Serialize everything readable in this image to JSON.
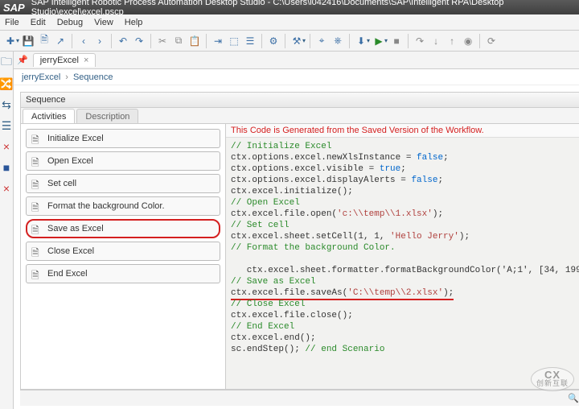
{
  "title": "SAP Intelligent Robotic Process Automation Desktop Studio - C:\\Users\\i042416\\Documents\\SAP\\Intelligent RPA\\Desktop Studio\\excel\\excel.pscp",
  "menu": {
    "file": "File",
    "edit": "Edit",
    "debug": "Debug",
    "view": "View",
    "help": "Help"
  },
  "tab": {
    "name": "jerryExcel"
  },
  "breadcrumb": {
    "root": "jerryExcel",
    "leaf": "Sequence"
  },
  "seq": {
    "title": "Sequence"
  },
  "subtabs": {
    "activities": "Activities",
    "description": "Description"
  },
  "activities": {
    "a0": "Initialize Excel",
    "a1": "Open Excel",
    "a2": "Set cell",
    "a3": "Format the background Color.",
    "a4": "Save as Excel",
    "a5": "Close Excel",
    "a6": "End Excel"
  },
  "notice": "This Code is Generated from the Saved Version of the Workflow.",
  "code": {
    "c0": "// Initialize Excel",
    "l1": "ctx.options.excel.newXlsInstance = ",
    "l1k": "false",
    "l1e": ";",
    "l2": "ctx.options.excel.visible = ",
    "l2k": "true",
    "l2e": ";",
    "l3": "ctx.options.excel.displayAlerts = ",
    "l3k": "false",
    "l3e": ";",
    "l4": "ctx.excel.initialize();",
    "c5": "// Open Excel",
    "l6a": "ctx.excel.file.open(",
    "l6s": "'c:\\\\temp\\\\1.xlsx'",
    "l6e": ");",
    "c7": "// Set cell",
    "l8a": "ctx.excel.sheet.setCell(1, 1, ",
    "l8s": "'Hello Jerry'",
    "l8e": ");",
    "c9": "// Format the background Color.",
    "l10": "   ctx.excel.sheet.formatter.formatBackgroundColor('A;1', [34, 199",
    "c11": "// Save as Excel",
    "l12a": "ctx.excel.file.saveAs(",
    "l12s": "'C:\\\\temp\\\\2.xlsx'",
    "l12e": ");",
    "c13": "// Close Excel",
    "l14": "ctx.excel.file.close();",
    "c15": "// End Excel",
    "l16": "ctx.excel.end();",
    "l17a": "sc.endStep(); ",
    "l17c": "// end Scenario"
  },
  "watermark": {
    "top": "CX",
    "bottom": "创新互联"
  }
}
